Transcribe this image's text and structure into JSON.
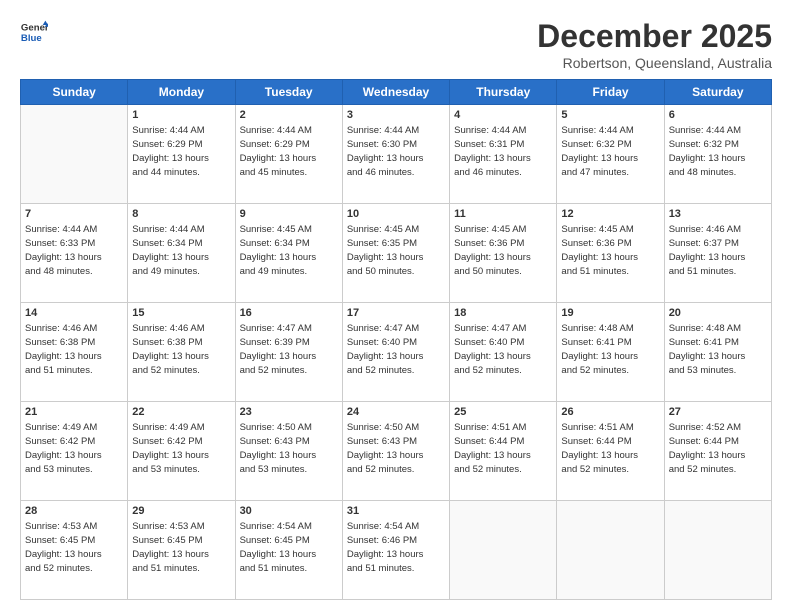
{
  "logo": {
    "line1": "General",
    "line2": "Blue"
  },
  "title": "December 2025",
  "subtitle": "Robertson, Queensland, Australia",
  "days_header": [
    "Sunday",
    "Monday",
    "Tuesday",
    "Wednesday",
    "Thursday",
    "Friday",
    "Saturday"
  ],
  "weeks": [
    [
      {
        "num": "",
        "info": ""
      },
      {
        "num": "1",
        "info": "Sunrise: 4:44 AM\nSunset: 6:29 PM\nDaylight: 13 hours\nand 44 minutes."
      },
      {
        "num": "2",
        "info": "Sunrise: 4:44 AM\nSunset: 6:29 PM\nDaylight: 13 hours\nand 45 minutes."
      },
      {
        "num": "3",
        "info": "Sunrise: 4:44 AM\nSunset: 6:30 PM\nDaylight: 13 hours\nand 46 minutes."
      },
      {
        "num": "4",
        "info": "Sunrise: 4:44 AM\nSunset: 6:31 PM\nDaylight: 13 hours\nand 46 minutes."
      },
      {
        "num": "5",
        "info": "Sunrise: 4:44 AM\nSunset: 6:32 PM\nDaylight: 13 hours\nand 47 minutes."
      },
      {
        "num": "6",
        "info": "Sunrise: 4:44 AM\nSunset: 6:32 PM\nDaylight: 13 hours\nand 48 minutes."
      }
    ],
    [
      {
        "num": "7",
        "info": "Sunrise: 4:44 AM\nSunset: 6:33 PM\nDaylight: 13 hours\nand 48 minutes."
      },
      {
        "num": "8",
        "info": "Sunrise: 4:44 AM\nSunset: 6:34 PM\nDaylight: 13 hours\nand 49 minutes."
      },
      {
        "num": "9",
        "info": "Sunrise: 4:45 AM\nSunset: 6:34 PM\nDaylight: 13 hours\nand 49 minutes."
      },
      {
        "num": "10",
        "info": "Sunrise: 4:45 AM\nSunset: 6:35 PM\nDaylight: 13 hours\nand 50 minutes."
      },
      {
        "num": "11",
        "info": "Sunrise: 4:45 AM\nSunset: 6:36 PM\nDaylight: 13 hours\nand 50 minutes."
      },
      {
        "num": "12",
        "info": "Sunrise: 4:45 AM\nSunset: 6:36 PM\nDaylight: 13 hours\nand 51 minutes."
      },
      {
        "num": "13",
        "info": "Sunrise: 4:46 AM\nSunset: 6:37 PM\nDaylight: 13 hours\nand 51 minutes."
      }
    ],
    [
      {
        "num": "14",
        "info": "Sunrise: 4:46 AM\nSunset: 6:38 PM\nDaylight: 13 hours\nand 51 minutes."
      },
      {
        "num": "15",
        "info": "Sunrise: 4:46 AM\nSunset: 6:38 PM\nDaylight: 13 hours\nand 52 minutes."
      },
      {
        "num": "16",
        "info": "Sunrise: 4:47 AM\nSunset: 6:39 PM\nDaylight: 13 hours\nand 52 minutes."
      },
      {
        "num": "17",
        "info": "Sunrise: 4:47 AM\nSunset: 6:40 PM\nDaylight: 13 hours\nand 52 minutes."
      },
      {
        "num": "18",
        "info": "Sunrise: 4:47 AM\nSunset: 6:40 PM\nDaylight: 13 hours\nand 52 minutes."
      },
      {
        "num": "19",
        "info": "Sunrise: 4:48 AM\nSunset: 6:41 PM\nDaylight: 13 hours\nand 52 minutes."
      },
      {
        "num": "20",
        "info": "Sunrise: 4:48 AM\nSunset: 6:41 PM\nDaylight: 13 hours\nand 53 minutes."
      }
    ],
    [
      {
        "num": "21",
        "info": "Sunrise: 4:49 AM\nSunset: 6:42 PM\nDaylight: 13 hours\nand 53 minutes."
      },
      {
        "num": "22",
        "info": "Sunrise: 4:49 AM\nSunset: 6:42 PM\nDaylight: 13 hours\nand 53 minutes."
      },
      {
        "num": "23",
        "info": "Sunrise: 4:50 AM\nSunset: 6:43 PM\nDaylight: 13 hours\nand 53 minutes."
      },
      {
        "num": "24",
        "info": "Sunrise: 4:50 AM\nSunset: 6:43 PM\nDaylight: 13 hours\nand 52 minutes."
      },
      {
        "num": "25",
        "info": "Sunrise: 4:51 AM\nSunset: 6:44 PM\nDaylight: 13 hours\nand 52 minutes."
      },
      {
        "num": "26",
        "info": "Sunrise: 4:51 AM\nSunset: 6:44 PM\nDaylight: 13 hours\nand 52 minutes."
      },
      {
        "num": "27",
        "info": "Sunrise: 4:52 AM\nSunset: 6:44 PM\nDaylight: 13 hours\nand 52 minutes."
      }
    ],
    [
      {
        "num": "28",
        "info": "Sunrise: 4:53 AM\nSunset: 6:45 PM\nDaylight: 13 hours\nand 52 minutes."
      },
      {
        "num": "29",
        "info": "Sunrise: 4:53 AM\nSunset: 6:45 PM\nDaylight: 13 hours\nand 51 minutes."
      },
      {
        "num": "30",
        "info": "Sunrise: 4:54 AM\nSunset: 6:45 PM\nDaylight: 13 hours\nand 51 minutes."
      },
      {
        "num": "31",
        "info": "Sunrise: 4:54 AM\nSunset: 6:46 PM\nDaylight: 13 hours\nand 51 minutes."
      },
      {
        "num": "",
        "info": ""
      },
      {
        "num": "",
        "info": ""
      },
      {
        "num": "",
        "info": ""
      }
    ]
  ]
}
